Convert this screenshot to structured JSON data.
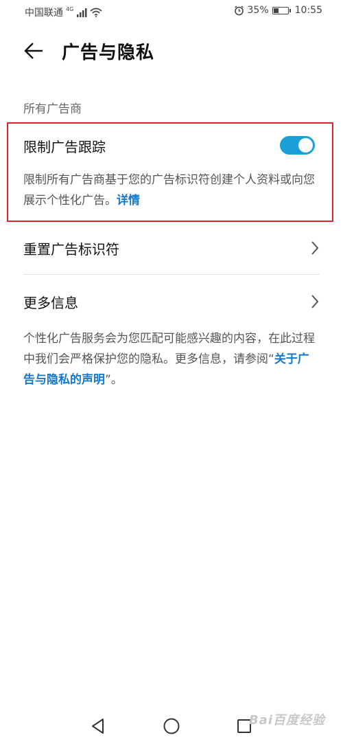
{
  "status_bar": {
    "carrier": "中国联通",
    "network": "4G",
    "battery_percent": "35%",
    "battery_level": 0.35,
    "time": "10:55",
    "icons": [
      "signal-icon",
      "wifi-icon",
      "alarm-icon",
      "battery-icon"
    ]
  },
  "header": {
    "back_icon": "back-arrow-icon",
    "title": "广告与隐私"
  },
  "section": {
    "caption": "所有广告商"
  },
  "limit_tracking": {
    "title": "限制广告跟踪",
    "enabled": true,
    "description": "限制所有广告商基于您的广告标识符创建个人资料或向您展示个性化广告。",
    "details_link": "详情",
    "highlight_color": "#d9232d",
    "toggle_color": "#1a9fd6"
  },
  "rows": [
    {
      "label": "重置广告标识符",
      "icon": "chevron-right-icon"
    },
    {
      "label": "更多信息",
      "icon": "chevron-right-icon"
    }
  ],
  "info": {
    "text_before": "个性化广告服务会为您匹配可能感兴趣的内容，在此过程中我们会严格保护您的隐私。更多信息，请参阅“",
    "link": "关于广告与隐私的声明",
    "text_after": "”。",
    "link_color": "#1478cc"
  },
  "nav_bar": {
    "buttons": [
      "back-triangle-icon",
      "home-circle-icon",
      "recents-square-icon"
    ]
  },
  "watermark": "Bai百度经验"
}
